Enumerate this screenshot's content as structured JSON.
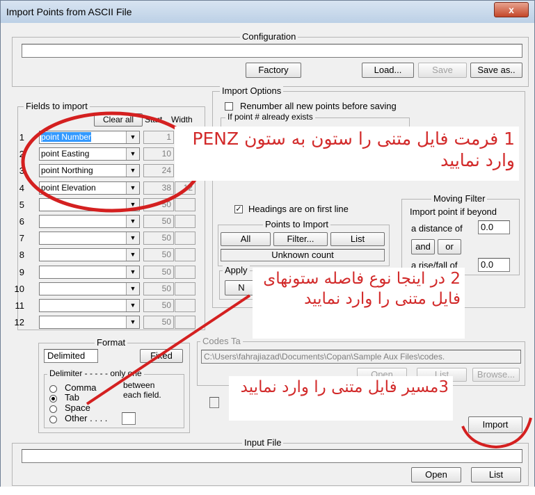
{
  "window": {
    "title": "Import Points from ASCII File",
    "close_glyph": "x"
  },
  "configuration": {
    "label": "Configuration",
    "value": "",
    "buttons": {
      "factory": "Factory",
      "load": "Load...",
      "save": "Save",
      "save_as": "Save as.."
    }
  },
  "fields": {
    "label": "Fields to import",
    "clear_all": "Clear all",
    "col_start": "Start",
    "col_width": "Width",
    "rows": [
      {
        "n": "1",
        "field": "point Number",
        "start": "1",
        "width": ""
      },
      {
        "n": "2",
        "field": "point Easting",
        "start": "10",
        "width": ""
      },
      {
        "n": "3",
        "field": "point Northing",
        "start": "24",
        "width": ""
      },
      {
        "n": "4",
        "field": "point Elevation",
        "start": "38",
        "width": "12"
      },
      {
        "n": "5",
        "field": "",
        "start": "50",
        "width": ""
      },
      {
        "n": "6",
        "field": "",
        "start": "50",
        "width": ""
      },
      {
        "n": "7",
        "field": "",
        "start": "50",
        "width": ""
      },
      {
        "n": "8",
        "field": "",
        "start": "50",
        "width": ""
      },
      {
        "n": "9",
        "field": "",
        "start": "50",
        "width": ""
      },
      {
        "n": "10",
        "field": "",
        "start": "50",
        "width": ""
      },
      {
        "n": "11",
        "field": "",
        "start": "50",
        "width": ""
      },
      {
        "n": "12",
        "field": "",
        "start": "50",
        "width": ""
      }
    ]
  },
  "import_options": {
    "label": "Import Options",
    "renumber": "Renumber all new points before saving",
    "if_exists": "If point # already exists",
    "headings": "Headings are on first line",
    "points_to_import": {
      "label": "Points to Import",
      "all": "All",
      "filter": "Filter...",
      "list": "List",
      "count": "Unknown count"
    },
    "apply": "Apply",
    "apply_value": "N"
  },
  "moving_filter": {
    "label": "Moving Filter",
    "line1": "Import point if beyond",
    "distance_label": "a distance of",
    "distance_value": "0.0",
    "and": "and",
    "or": "or",
    "rise_label": "a rise/fall of",
    "rise_value": "0.0"
  },
  "format": {
    "label": "Format",
    "delimited": "Delimited",
    "fixed": "Fixed",
    "delimiter_label": "Delimiter - - - - - only one",
    "between": "between",
    "each_field": "each field.",
    "options": [
      "Comma",
      "Tab",
      "Space",
      "Other . . . ."
    ],
    "selected": "Tab"
  },
  "codes": {
    "label": "Codes Ta",
    "path": "C:\\Users\\fahrajiazad\\Documents\\Copan\\Sample Aux Files\\codes.",
    "open": "Open",
    "list": "List",
    "browse": "Browse..."
  },
  "import_button": "Import",
  "input_file": {
    "label": "Input File",
    "value": "",
    "open": "Open",
    "list": "List"
  },
  "annotations": {
    "note1": "1 فرمت فایل متنی را ستون به ستون PENZ وارد نمایید",
    "note2": "2 در اینجا نوع فاصله ستونهای فایل متنی را وارد نمایید",
    "note3": "3مسیر فایل متنی را وارد نمایید",
    "color": "#d22a2a"
  }
}
